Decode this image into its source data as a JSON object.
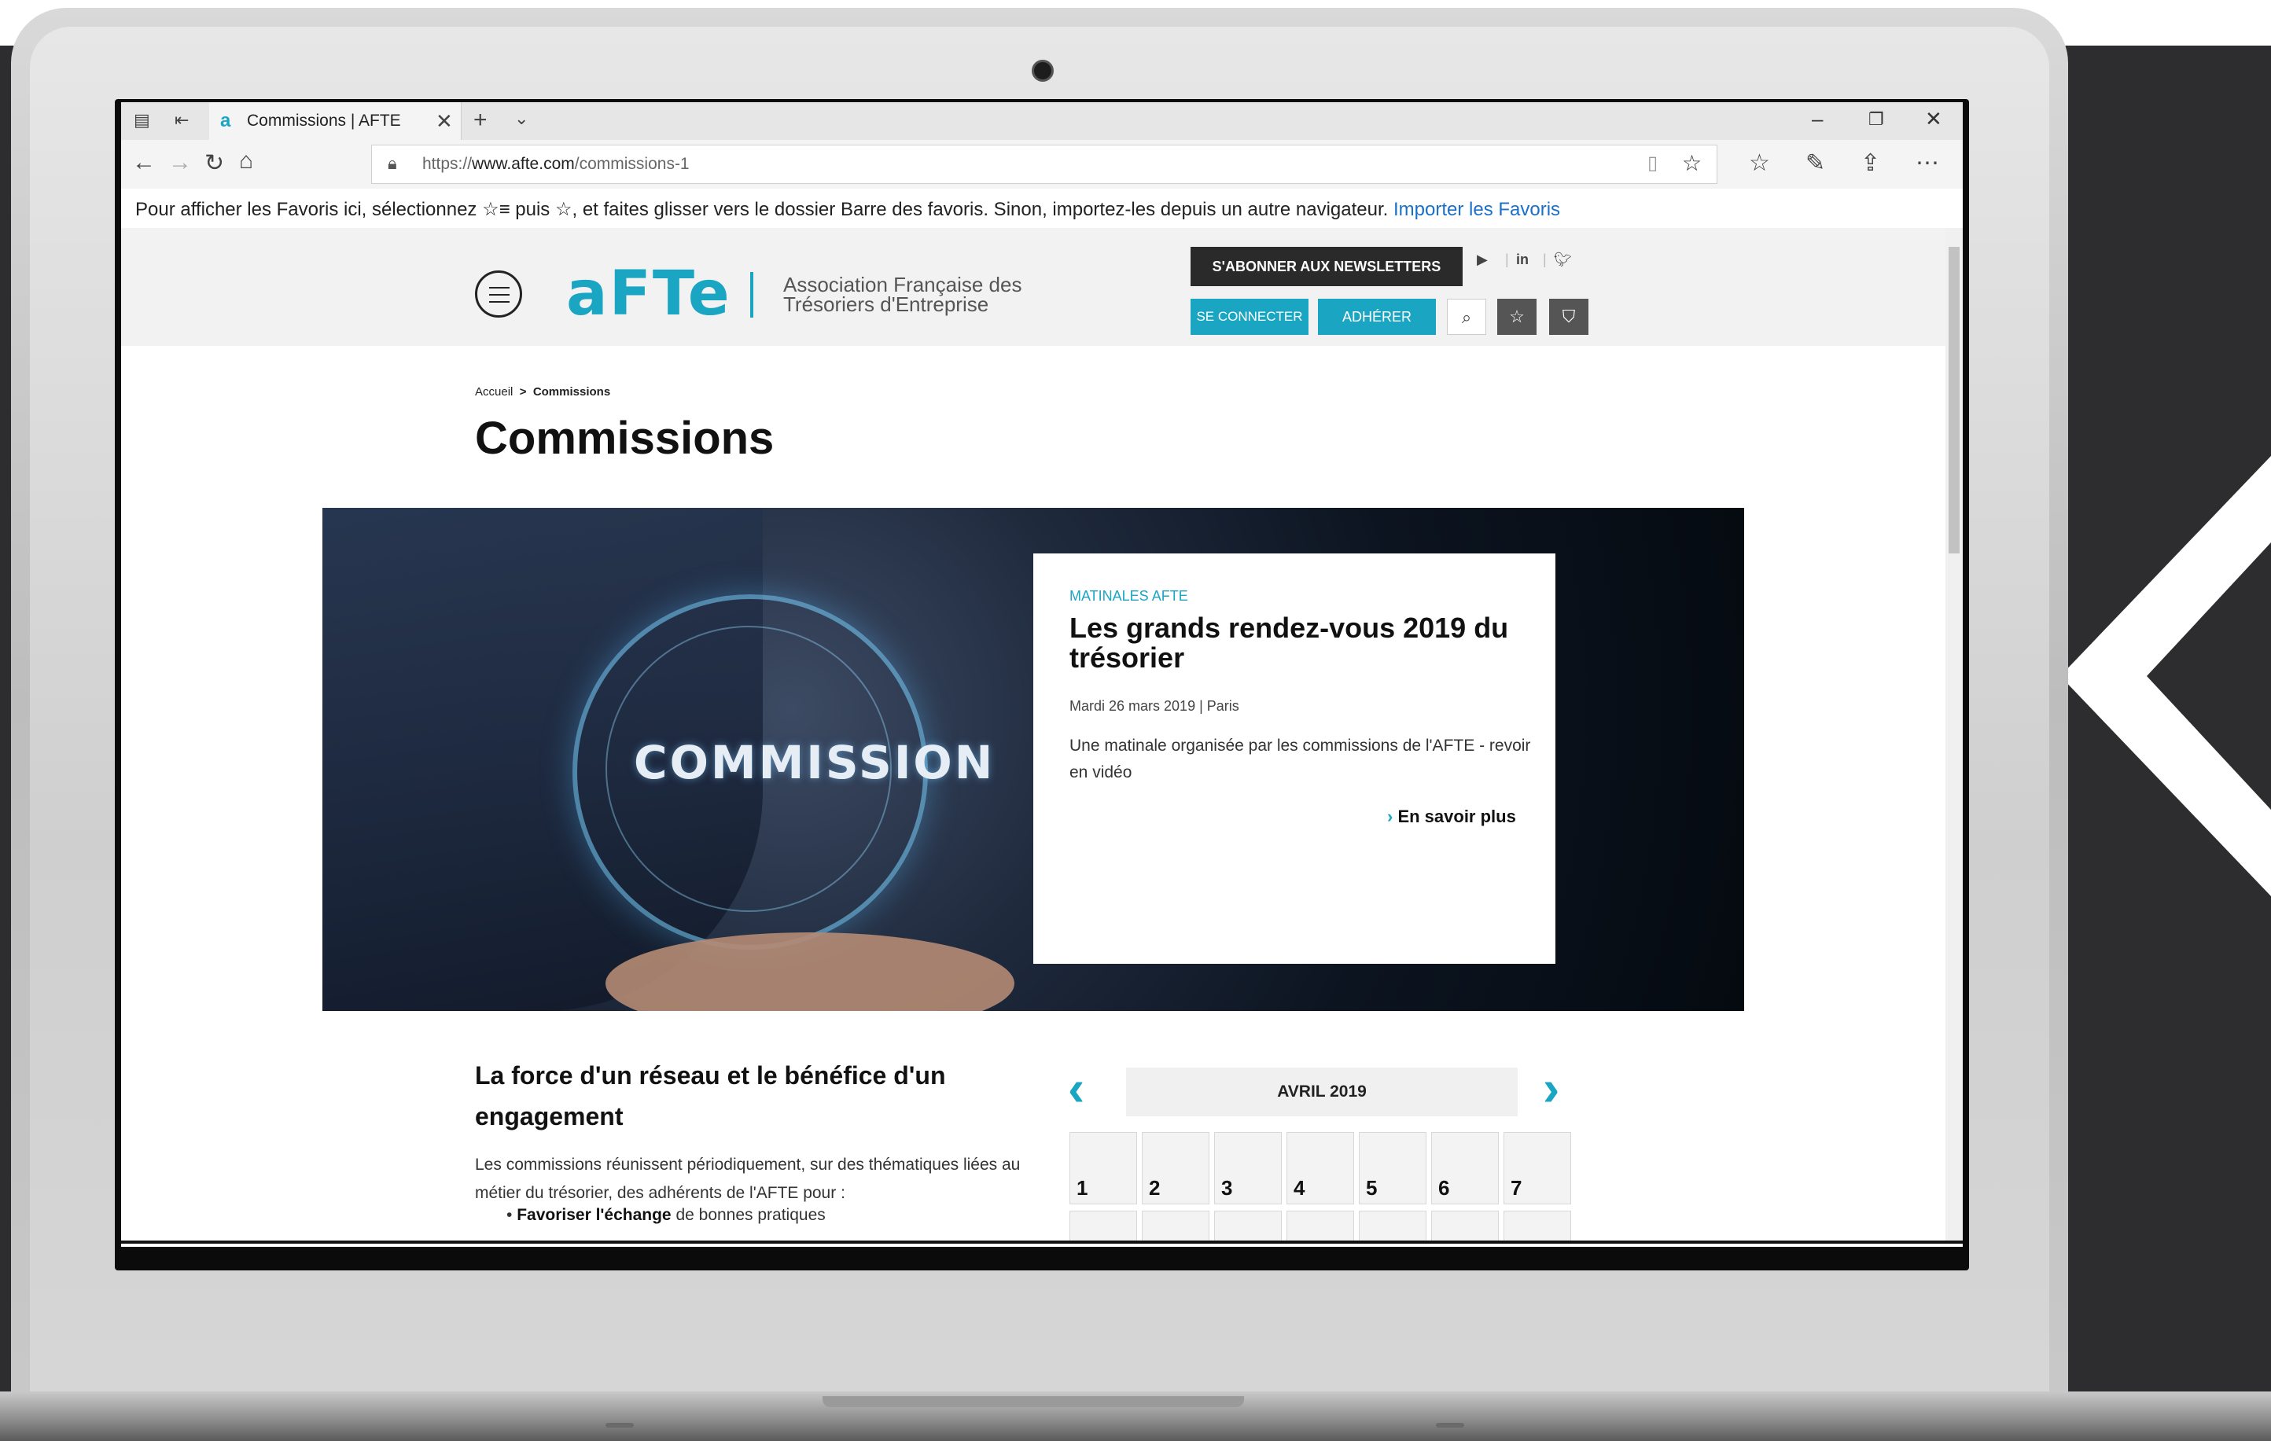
{
  "browser": {
    "tab_title": "Commissions | AFTE",
    "tab_favicon": "a",
    "url_prefix": "https://",
    "url_domain": "www.afte.com",
    "url_path": "/commissions-1",
    "favorites_bar_text": "Pour afficher les Favoris ici, sélectionnez ☆≡ puis ☆, et faites glisser vers le dossier Barre des favoris. Sinon, importez-les depuis un autre navigateur.",
    "favorites_bar_link": "Importer les Favoris"
  },
  "site": {
    "logo": "aFTe",
    "tagline_line1": "Association Française des",
    "tagline_line2": "Trésoriers d'Entreprise",
    "newsletter_button": "S'ABONNER AUX NEWSLETTERS",
    "login_button": "SE CONNECTER",
    "join_button": "ADHÉRER",
    "breadcrumb_home": "Accueil",
    "breadcrumb_sep": ">",
    "breadcrumb_current": "Commissions",
    "page_title": "Commissions"
  },
  "hero": {
    "image_label": "COMMISSION",
    "card_kicker": "MATINALES AFTE",
    "card_title": "Les grands rendez-vous 2019 du trésorier",
    "card_meta": "Mardi 26 mars 2019 | Paris",
    "card_description": "Une matinale organisée par les commissions de l'AFTE - revoir en vidéo",
    "card_link": "En savoir plus"
  },
  "section": {
    "title": "La force d'un réseau et le bénéfice d'un engagement",
    "text": "Les commissions réunissent périodiquement, sur des thématiques liées au métier du trésorier, des adhérents de l'AFTE pour :",
    "bullet_bold": "Favoriser l'échange",
    "bullet_rest": " de bonnes pratiques"
  },
  "calendar": {
    "month": "AVRIL 2019",
    "days": [
      "1",
      "2",
      "3",
      "4",
      "5",
      "6",
      "7"
    ]
  },
  "colors": {
    "accent": "#1aa6c2",
    "dark_button": "#2a2a2a",
    "backdrop": "#2d2d2f"
  }
}
